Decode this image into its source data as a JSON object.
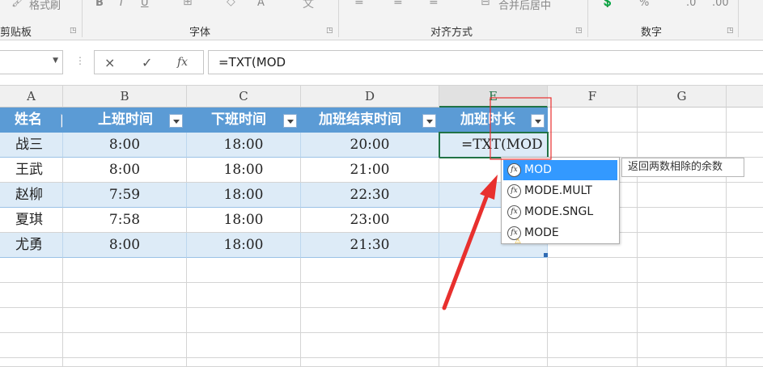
{
  "ribbon": {
    "format_painter": "格式刷",
    "groups": [
      "剪贴板",
      "字体",
      "对齐方式",
      "数字"
    ],
    "merge_center": "合并后居中",
    "percent": "%",
    "sep": "›"
  },
  "formula_bar": {
    "cancel_icon": "×",
    "confirm_icon": "✓",
    "fx_label": "fx",
    "formula": "=TXT(MOD"
  },
  "columns": [
    "A",
    "B",
    "C",
    "D",
    "E",
    "F",
    "G"
  ],
  "table": {
    "headers": [
      "姓名",
      "上班时间",
      "下班时间",
      "加班结束时间",
      "加班时长"
    ],
    "rows": [
      {
        "name": "战三",
        "start": "8:00",
        "end": "18:00",
        "ot_end": "20:00"
      },
      {
        "name": "王武",
        "start": "8:00",
        "end": "18:00",
        "ot_end": "21:00"
      },
      {
        "name": "赵柳",
        "start": "7:59",
        "end": "18:00",
        "ot_end": "22:30"
      },
      {
        "name": "夏琪",
        "start": "7:58",
        "end": "18:00",
        "ot_end": "23:00"
      },
      {
        "name": "尤勇",
        "start": "8:00",
        "end": "18:00",
        "ot_end": "21:30"
      }
    ],
    "editing_text": "=TXT(MOD"
  },
  "autocomplete": {
    "items": [
      "MOD",
      "MODE.MULT",
      "MODE.SNGL",
      "MODE"
    ],
    "selected": "MOD",
    "tooltip": "返回两数相除的余数",
    "fx_icon_text": "fx",
    "warn_icon_text": "⚠"
  },
  "colors": {
    "table_header": "#5b9bd5",
    "band_row": "#ddebf7",
    "selection_green": "#217346",
    "annotation_red": "#e8302e",
    "autocomplete_highlight": "#3399ff"
  }
}
